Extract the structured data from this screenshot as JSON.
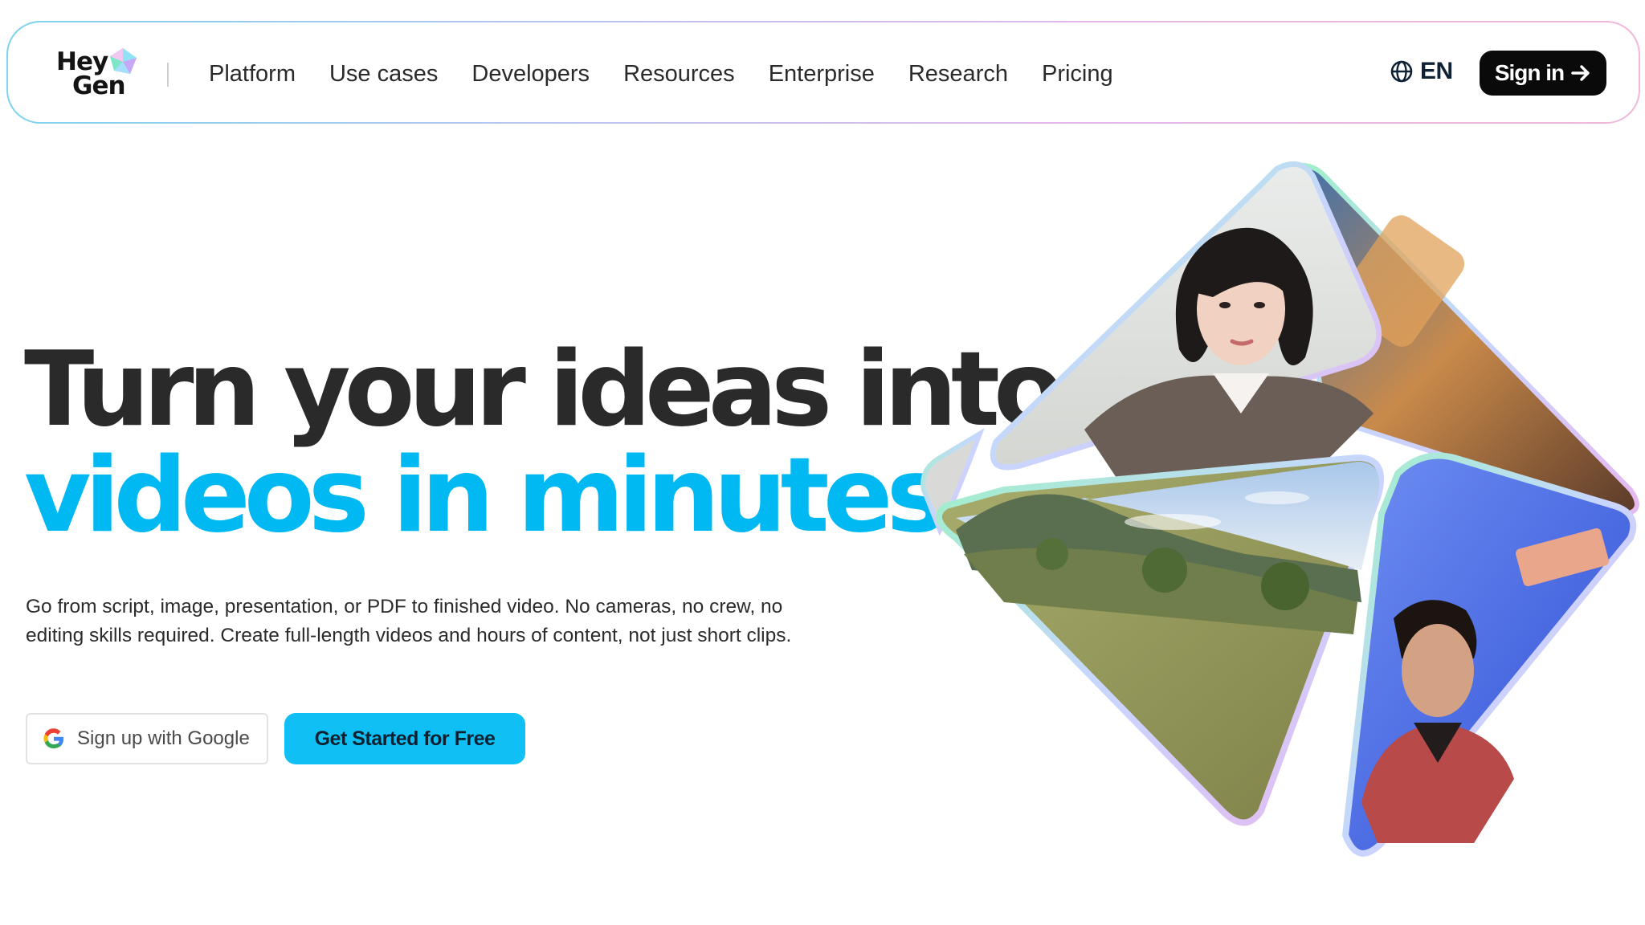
{
  "brand": {
    "logo_line1": "Hey",
    "logo_line2": "Gen"
  },
  "nav": {
    "items": [
      {
        "label": "Platform"
      },
      {
        "label": "Use cases"
      },
      {
        "label": "Developers"
      },
      {
        "label": "Resources"
      },
      {
        "label": "Enterprise"
      },
      {
        "label": "Research"
      },
      {
        "label": "Pricing"
      }
    ],
    "language": "EN",
    "signin_label": "Sign in"
  },
  "hero": {
    "headline_line1": "Turn your ideas into",
    "headline_line2": "videos in minutes",
    "subtext": "Go from script, image, presentation, or PDF to finished video. No cameras, no crew, no editing skills required. Create full-length videos and hours of content, not just short clips.",
    "google_button_label": "Sign up with Google",
    "cta_label": "Get Started for Free"
  },
  "colors": {
    "accent": "#00b9f2",
    "cta_bg": "#10bff4",
    "dark": "#0a0a0a"
  },
  "icons": {
    "language": "globe-icon",
    "signin": "arrow-right-icon",
    "google": "google-g-icon"
  }
}
